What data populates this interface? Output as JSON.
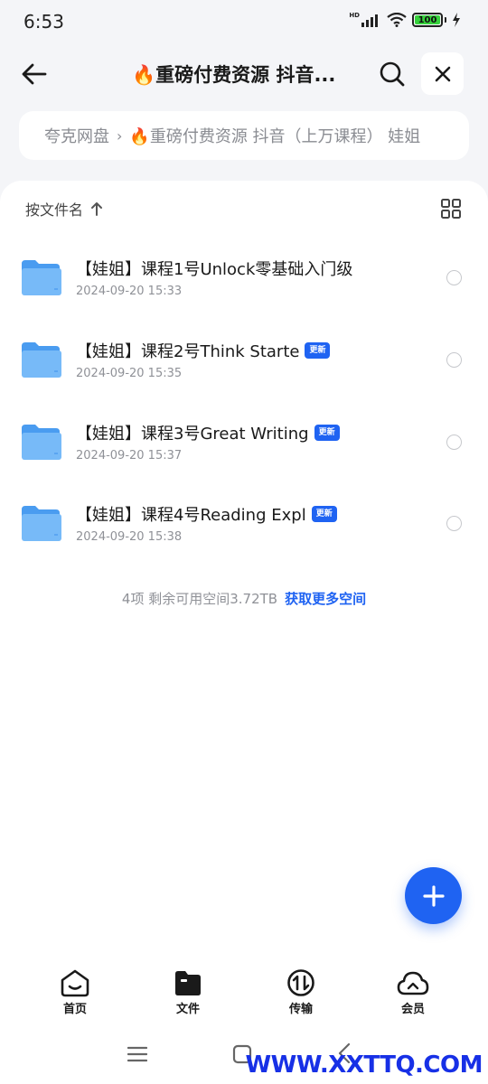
{
  "status": {
    "time": "6:53",
    "battery": "100",
    "network": "HD"
  },
  "header": {
    "title": "🔥重磅付费资源  抖音..."
  },
  "breadcrumb": {
    "root": "夸克网盘",
    "path": "🔥重磅付费资源  抖音（上万课程）  娃姐"
  },
  "toolbar": {
    "sort_label": "按文件名"
  },
  "files": [
    {
      "name": "【娃姐】课程1号Unlock零基础入门级",
      "date": "2024-09-20 15:33",
      "badge": ""
    },
    {
      "name": "【娃姐】课程2号Think Starte",
      "date": "2024-09-20 15:35",
      "badge": "更新"
    },
    {
      "name": "【娃姐】课程3号Great Writing",
      "date": "2024-09-20 15:37",
      "badge": "更新"
    },
    {
      "name": "【娃姐】课程4号Reading Expl",
      "date": "2024-09-20 15:38",
      "badge": "更新"
    }
  ],
  "footer": {
    "summary": "4项 剩余可用空间3.72TB",
    "link": "获取更多空间"
  },
  "bottom_nav": [
    {
      "label": "首页",
      "icon": "home-icon"
    },
    {
      "label": "文件",
      "icon": "folder-icon"
    },
    {
      "label": "传输",
      "icon": "transfer-icon"
    },
    {
      "label": "会员",
      "icon": "cloud-icon"
    }
  ],
  "watermark": "WWW.XXTTQ.COM",
  "colors": {
    "accent": "#1f63f2",
    "folder": "#5fb0f7",
    "battery": "#36d13c"
  }
}
